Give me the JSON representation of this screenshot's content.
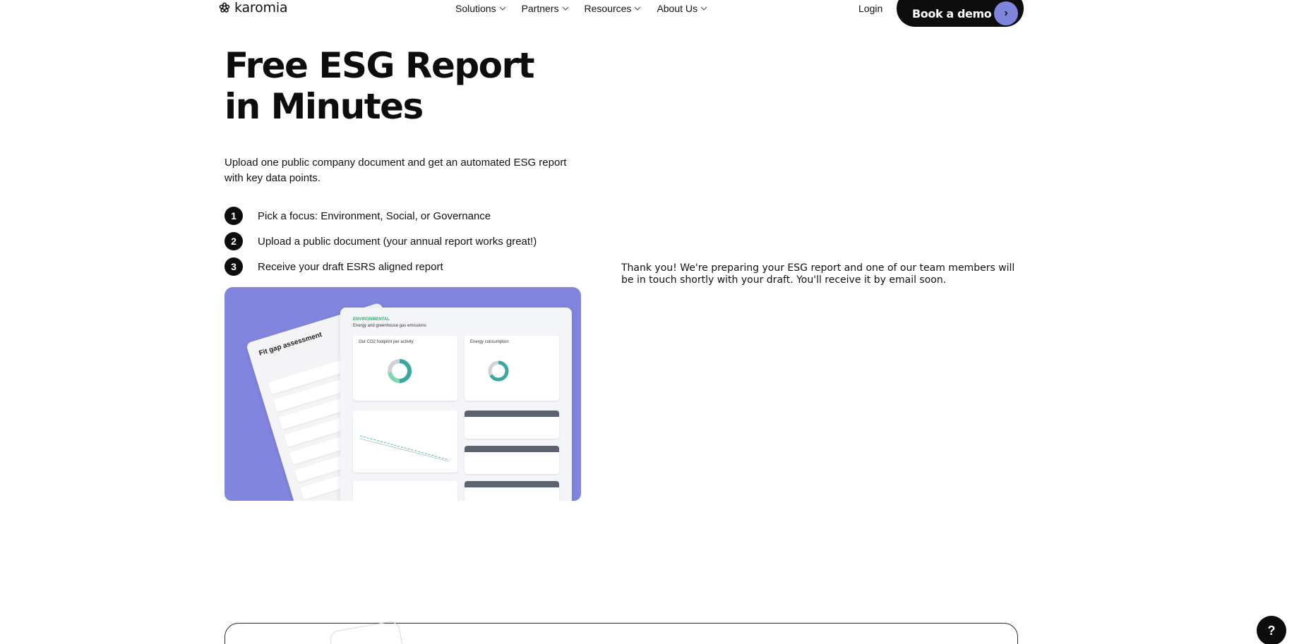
{
  "header": {
    "logo_text": "karomia",
    "nav": [
      {
        "label": "Solutions"
      },
      {
        "label": "Partners"
      },
      {
        "label": "Resources"
      },
      {
        "label": "About Us"
      }
    ],
    "login_label": "Login",
    "demo_label": "Book a demo",
    "demo_arrow": "›"
  },
  "hero": {
    "title_line1": "Free ESG Report",
    "title_line2": "in Minutes",
    "subtitle": "Upload one public company document and get an automated ESG report with key data points.",
    "steps": [
      {
        "num": "1",
        "text": "Pick a focus: Environment, Social, or Governance"
      },
      {
        "num": "2",
        "text": "Upload a public document (your annual report works great!)"
      },
      {
        "num": "3",
        "text": "Receive your draft ESRS aligned report"
      }
    ]
  },
  "illustration": {
    "fit_gap_title": "Fit gap assessment",
    "env_label": "ENVIRONMENTAL",
    "env_sub": "Energy and greenhouse gas emissions",
    "card1_title": "Our CO2 footprint per activity",
    "card2_title": "Energy consumption",
    "accent_color": "#8285dd"
  },
  "thanks_message": "Thank you! We're preparing your ESG report and one of our team members will be in touch shortly with your draft. You'll receive it by email soon.",
  "help_label": "?"
}
